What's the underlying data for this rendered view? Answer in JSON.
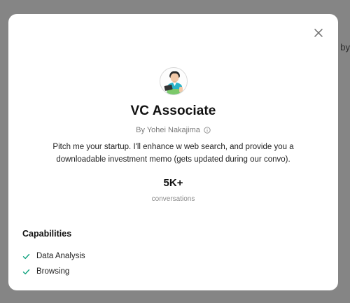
{
  "background": {
    "fragment_text": "by"
  },
  "modal": {
    "close_icon": "close-icon",
    "avatar_icon": "gpt-avatar-illustration",
    "title": "VC Associate",
    "author": "By Yohei Nakajima",
    "description": "Pitch me your startup. I'll enhance w web search, and provide you a downloadable investment memo (gets updated during our convo).",
    "stats": {
      "value": "5K+",
      "label": "conversations"
    },
    "capabilities": {
      "heading": "Capabilities",
      "items": [
        {
          "label": "Data Analysis",
          "icon": "check-icon"
        },
        {
          "label": "Browsing",
          "icon": "check-icon"
        }
      ]
    }
  },
  "colors": {
    "check": "#10a37f",
    "text": "#111111",
    "muted": "#7a7a7a"
  }
}
